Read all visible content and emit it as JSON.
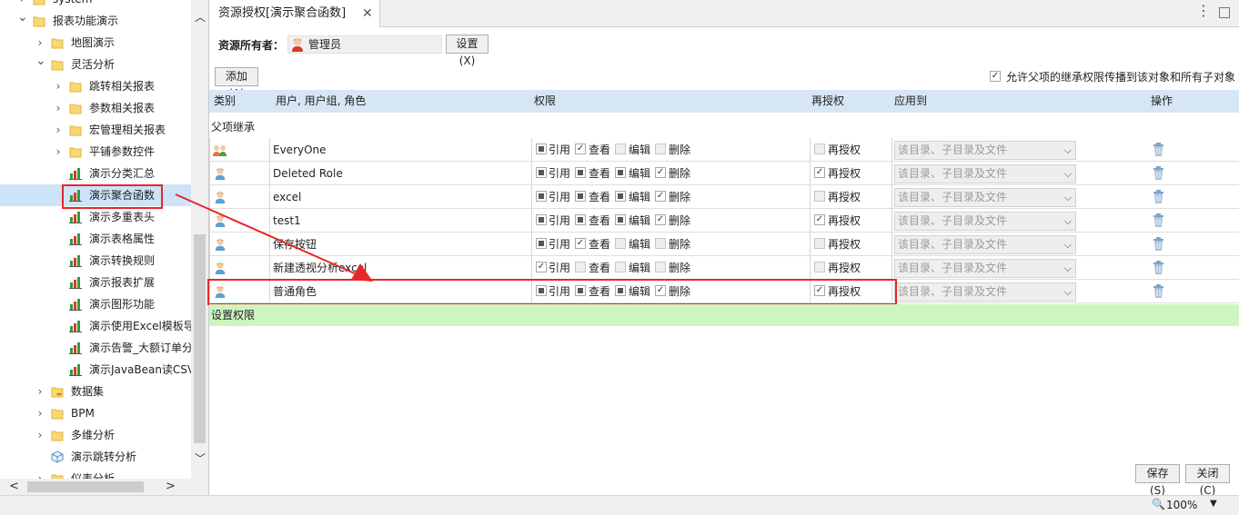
{
  "tree": {
    "items": [
      {
        "label": "system",
        "arrow": ">",
        "icon": "folder"
      },
      {
        "label": "报表功能演示",
        "arrow": "v",
        "icon": "folder"
      },
      {
        "label": "地图演示",
        "arrow": ">",
        "icon": "folder"
      },
      {
        "label": "灵活分析",
        "arrow": "v",
        "icon": "folder"
      },
      {
        "label": "跳转相关报表",
        "arrow": ">",
        "icon": "folder"
      },
      {
        "label": "参数相关报表",
        "arrow": ">",
        "icon": "folder"
      },
      {
        "label": "宏管理相关报表",
        "arrow": ">",
        "icon": "folder"
      },
      {
        "label": "平铺参数控件",
        "arrow": ">",
        "icon": "folder"
      },
      {
        "label": "演示分类汇总",
        "arrow": "",
        "icon": "chart"
      },
      {
        "label": "演示聚合函数",
        "arrow": "",
        "icon": "chart",
        "selected": true
      },
      {
        "label": "演示多重表头",
        "arrow": "",
        "icon": "chart"
      },
      {
        "label": "演示表格属性",
        "arrow": "",
        "icon": "chart"
      },
      {
        "label": "演示转换规则",
        "arrow": "",
        "icon": "chart"
      },
      {
        "label": "演示报表扩展",
        "arrow": "",
        "icon": "chart"
      },
      {
        "label": "演示图形功能",
        "arrow": "",
        "icon": "chart"
      },
      {
        "label": "演示使用Excel模板导",
        "arrow": "",
        "icon": "chart"
      },
      {
        "label": "演示告警_大额订单分",
        "arrow": "",
        "icon": "chart"
      },
      {
        "label": "演示JavaBean读CSV",
        "arrow": "",
        "icon": "chart"
      },
      {
        "label": "数据集",
        "arrow": ">",
        "icon": "folder-db"
      },
      {
        "label": "BPM",
        "arrow": ">",
        "icon": "folder"
      },
      {
        "label": "多维分析",
        "arrow": ">",
        "icon": "folder"
      },
      {
        "label": "演示跳转分析",
        "arrow": "",
        "icon": "cube"
      },
      {
        "label": "仪表分析",
        "arrow": ">",
        "icon": "folder"
      }
    ]
  },
  "tab": {
    "title": "资源授权[演示聚合函数]",
    "close": "✕"
  },
  "owner": {
    "label": "资源所有者：",
    "value": "管理员",
    "set_button": "设置(X)"
  },
  "add_button": "添加(A)",
  "inherit_checkbox": {
    "label": "允许父项的继承权限传播到该对象和所有子对象",
    "checked": true
  },
  "columns": {
    "type": "类别",
    "user": "用户, 用户组, 角色",
    "perm": "权限",
    "regrant": "再授权",
    "apply": "应用到",
    "op": "操作"
  },
  "section_label": "父项继承",
  "perm_labels": {
    "ref": "引用",
    "view": "查看",
    "edit": "编辑",
    "del": "删除",
    "regrant": "再授权"
  },
  "apply_text": "该目录、子目录及文件",
  "rows": [
    {
      "name": "EveryOne",
      "group": true,
      "ref": "part",
      "view": "check",
      "edit": "empty",
      "del": "empty",
      "regrant": "empty"
    },
    {
      "name": "Deleted Role",
      "group": false,
      "ref": "part",
      "view": "part",
      "edit": "part",
      "del": "check",
      "regrant": "check"
    },
    {
      "name": "excel",
      "group": false,
      "ref": "part",
      "view": "part",
      "edit": "part",
      "del": "check",
      "regrant": "empty"
    },
    {
      "name": "test1",
      "group": false,
      "ref": "part",
      "view": "part",
      "edit": "part",
      "del": "check",
      "regrant": "check"
    },
    {
      "name": "保存按钮",
      "group": false,
      "ref": "part",
      "view": "check",
      "edit": "empty",
      "del": "empty",
      "regrant": "empty"
    },
    {
      "name": "新建透视分析excel",
      "group": false,
      "ref": "check",
      "view": "empty",
      "edit": "empty",
      "del": "empty",
      "regrant": "empty"
    },
    {
      "name": "普通角色",
      "group": false,
      "ref": "part",
      "view": "part",
      "edit": "part",
      "del": "check",
      "regrant": "check"
    }
  ],
  "set_perm_label": "设置权限",
  "save_button": "保存(S)",
  "close_button": "关闭(C)",
  "zoom": "100%",
  "colors": {
    "highlight": "#e8262a",
    "selection": "#cde3f7",
    "header": "#d6e6f5",
    "set_row": "#ccf5bf"
  }
}
